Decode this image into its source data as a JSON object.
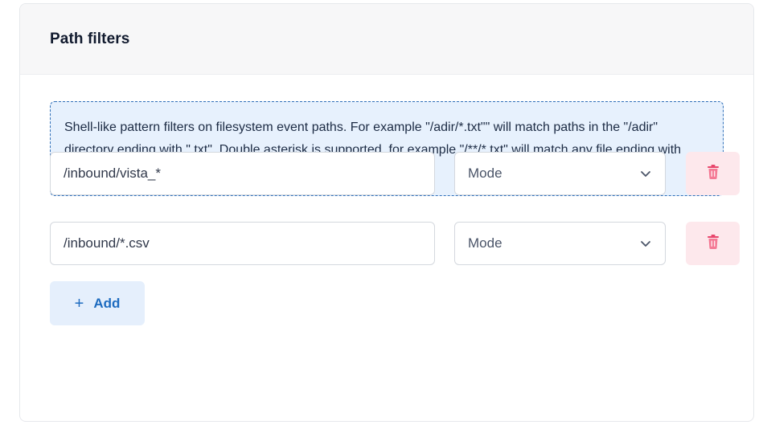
{
  "card": {
    "title": "Path filters"
  },
  "info": {
    "text": "Shell-like pattern filters on filesystem event paths. For example \"/adir/*.txt\"\" will match paths in the \"/adir\" directory ending with \".txt\". Double asterisk is supported, for example \"/**/*.txt\" will match any file ending with \".txt\". \"/mydir/**\" will match any entry in \"/mydir\""
  },
  "filters": [
    {
      "path": "/inbound/vista_*",
      "mode_placeholder": "Mode"
    },
    {
      "path": "/inbound/*.csv",
      "mode_placeholder": "Mode"
    }
  ],
  "add_button": {
    "icon": "plus-icon",
    "label": "Add"
  },
  "colors": {
    "info_background": "#e7f1fd",
    "info_border": "#2f6fb8",
    "delete_background": "#fde8ec",
    "delete_icon": "#e8466c",
    "add_background": "#e5effc",
    "add_text": "#1e6cc0"
  },
  "icons": {
    "delete": "trash-icon",
    "select": "chevron-down-icon"
  }
}
